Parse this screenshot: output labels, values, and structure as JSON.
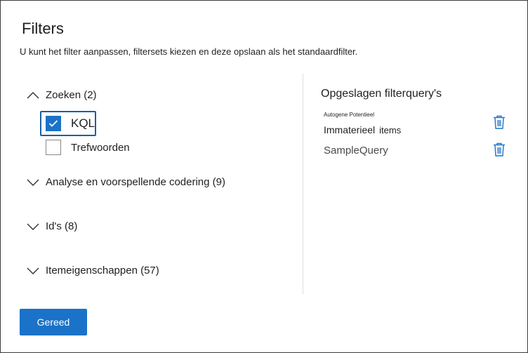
{
  "dialog": {
    "title": "Filters",
    "subtitle": "U kunt het filter aanpassen, filtersets kiezen en deze opslaan als het standaardfilter."
  },
  "filters": {
    "groups": [
      {
        "label": "Zoeken (2)",
        "expanded": true
      },
      {
        "label": "Analyse en voorspellende codering (9)",
        "expanded": false
      },
      {
        "label": "Id's (8)",
        "expanded": false
      },
      {
        "label": "Itemeigenschappen (57)",
        "expanded": false
      }
    ],
    "search_options": [
      {
        "label": "KQL",
        "checked": true
      },
      {
        "label": "Trefwoorden",
        "checked": false
      }
    ]
  },
  "saved": {
    "title": "Opgeslagen filterquery's",
    "queries": [
      {
        "tiny_label": "Autogene Potentieel",
        "name": "Immaterieel",
        "suffix": "items"
      },
      {
        "name": "SampleQuery"
      }
    ]
  },
  "footer": {
    "done_label": "Gereed"
  },
  "colors": {
    "accent": "#1a73c8",
    "border": "#3c3c3c",
    "divider": "#e1dfdd"
  },
  "icons": {
    "expand": "chevron-up-icon",
    "collapse": "chevron-down-icon",
    "delete": "trash-icon",
    "check": "checkmark-icon"
  }
}
